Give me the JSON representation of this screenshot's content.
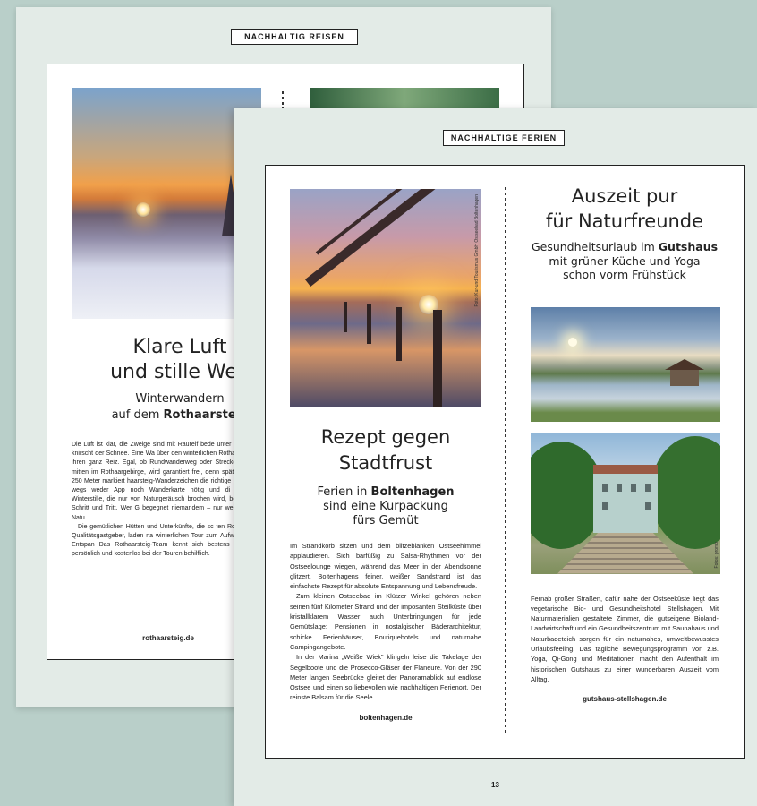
{
  "back_page": {
    "section_tag": "NACHHALTIG REISEN",
    "title_line1": "Klare Luft",
    "title_line2": "und stille Weg",
    "subtitle_line1": "Winterwandern",
    "subtitle_line2_pre": "auf dem ",
    "subtitle_line2_bold": "Rothaarsteig",
    "body": [
      "Die Luft ist klar, die Zweige sind mit Raureif bede unter den Füßen knirscht der Schnee. Eine Wa über den winterlichen Rothaarsteig hat ihren ganz Reiz. Egal, ob Rundwanderweg oder Streckenwar hier, mitten im Rothaargebirge, wird garantiert frei, denn spätestens alle 250 Meter markiert haarsteig-Wanderzeichen die richtige Route. So l wegs weder App noch Wanderkarte nötig und di gleichliche Winterstille, die nur von Naturgeräusch brochen wird, begleitet auf Schritt und Tritt. Wer G begegnet niemandem – nur weiter, weißer Natu",
      "Die gemütlichen Hütten und Unterkünfte, die sc ten Rothaarsteig-Qualitätsgastgeber, laden na winterlichen Tour zum Aufwärmen und Entspan Das Rothaarsteig-Team kennt sich bestens aus gerne persönlich und kostenlos bei der Touren behilflich."
    ],
    "link": "rothaarsteig.de"
  },
  "front_page": {
    "section_tag": "NACHHALTIGE FERIEN",
    "left": {
      "photo_credit": "Foto: Kur-und Tourismus GmbH Ostseebad Boltenhagen",
      "title_line1": "Rezept gegen",
      "title_line2": "Stadtfrust",
      "subtitle_line1_pre": "Ferien in ",
      "subtitle_line1_bold": "Boltenhagen",
      "subtitle_line2": "sind eine Kurpackung",
      "subtitle_line3": "fürs Gemüt",
      "body": [
        "Im Strandkorb sitzen und dem blitzeblanken Ostseehimmel applaudieren. Sich barfüßig zu Salsa-Rhythmen vor der Ostseelounge wiegen, während das Meer in der Abendsonne glitzert. Boltenhagens feiner, weißer Sandstrand ist das einfachste Rezept für absolute Entspannung und Lebensfreude.",
        "Zum kleinen Ostseebad im Klützer Winkel gehören neben seinen fünf Kilometer Strand und der imposanten Steilküste über kristallklarem Wasser auch Unterbringungen für jede Gemütslage: Pensionen in nostalgischer Bäderarchitektur, schicke Ferienhäuser, Boutiquehotels und naturnahe Campingangebote.",
        "In der Marina „Weiße Wiek\" klingeln leise die Takelage der Segelboote und die Prosecco-Gläser der Flaneure. Von der 290 Meter langen Seebrücke gleitet der Panoramablick auf endlose Ostsee und einen so liebevollen wie nachhaltigen Ferienort. Der reinste Balsam für die Seele."
      ],
      "link": "boltenhagen.de"
    },
    "right": {
      "title_line1": "Auszeit pur",
      "title_line2": "für Naturfreunde",
      "subtitle_line1_pre": "Gesundheitsurlaub im ",
      "subtitle_line1_bold": "Gutshaus",
      "subtitle_line2": "mit grüner Küche und Yoga",
      "subtitle_line3": "schon vorm Frühstück",
      "photo_credit": "Fotos: promo",
      "body": [
        "Fernab großer Straßen, dafür nahe der Ostseeküste liegt das vegetarische Bio- und Gesundheitshotel Stellshagen. Mit Naturmaterialien gestaltete Zimmer, die gutseigene Bioland-Landwirtschaft und ein Gesundheitszentrum mit Saunahaus und Naturbadeteich sorgen für ein naturnahes, umweltbewusstes Urlaubsfeeling. Das tägliche Bewegungsprogramm von z.B. Yoga, Qi-Gong und Meditationen macht den Aufenthalt im historischen Gutshaus zu einer wunderbaren Auszeit vom Alltag."
      ],
      "link": "gutshaus-stellshagen.de"
    },
    "page_number": "13"
  }
}
